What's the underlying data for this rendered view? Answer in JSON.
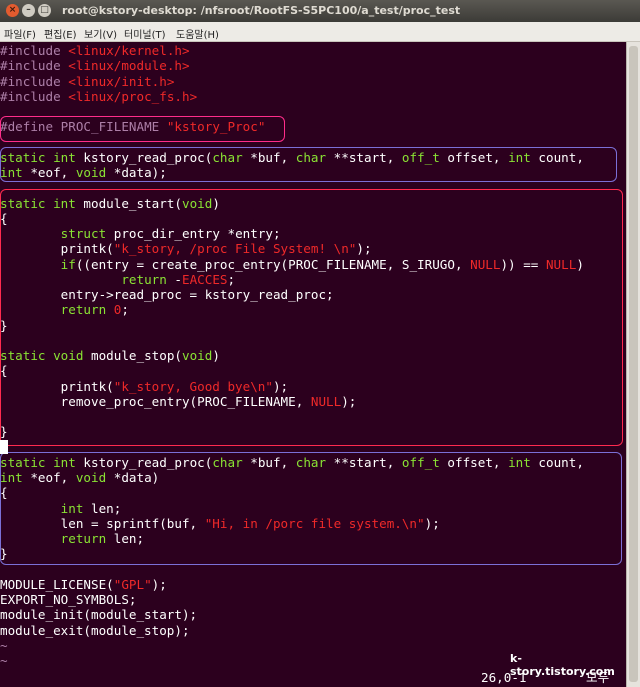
{
  "window": {
    "title": "root@kstory-desktop: /nfsroot/RootFS-S5PC100/a_test/proc_test",
    "close_glyph": "×",
    "min_glyph": "–",
    "max_glyph": "□"
  },
  "menu": [
    {
      "label": "파일(F)"
    },
    {
      "label": "편집(E)"
    },
    {
      "label": "보기(V)"
    },
    {
      "label": "터미널(T)"
    },
    {
      "label": "도움말(H)"
    }
  ],
  "editor": {
    "status_position": "26,0-1",
    "status_mode": "모두",
    "watermark": "k-story.tistory.com",
    "colors": {
      "background": "#2c001e",
      "keyword": "#8ae234",
      "preprocessor": "#ad7fa8",
      "string": "#ef2929",
      "box_include_define": "#ff2d8a",
      "box_prototype": "#7b6fd6",
      "box_module": "#ff2a4f"
    },
    "lines": [
      [
        {
          "t": "#include ",
          "c": "p"
        },
        {
          "t": "<linux/kernel.h>",
          "c": "s"
        }
      ],
      [
        {
          "t": "#include ",
          "c": "p"
        },
        {
          "t": "<linux/module.h>",
          "c": "s"
        }
      ],
      [
        {
          "t": "#include ",
          "c": "p"
        },
        {
          "t": "<linux/init.h>",
          "c": "s"
        }
      ],
      [
        {
          "t": "#include ",
          "c": "p"
        },
        {
          "t": "<linux/proc_fs.h>",
          "c": "s"
        }
      ],
      [],
      [
        {
          "t": "#define ",
          "c": "p"
        },
        {
          "t": "PROC_FILENAME ",
          "c": "c"
        },
        {
          "t": "\"kstory_Proc\"",
          "c": "s"
        }
      ],
      [],
      [
        {
          "t": "static",
          "c": "k"
        },
        {
          "t": " "
        },
        {
          "t": "int",
          "c": "k"
        },
        {
          "t": " kstory_read_proc("
        },
        {
          "t": "char",
          "c": "k"
        },
        {
          "t": " *buf, "
        },
        {
          "t": "char",
          "c": "k"
        },
        {
          "t": " **start, "
        },
        {
          "t": "off_t",
          "c": "k"
        },
        {
          "t": " offset, "
        },
        {
          "t": "int",
          "c": "k"
        },
        {
          "t": " count,"
        }
      ],
      [
        {
          "t": "int",
          "c": "k"
        },
        {
          "t": " *eof, "
        },
        {
          "t": "void",
          "c": "k"
        },
        {
          "t": " *data);"
        }
      ],
      [],
      [
        {
          "t": "static",
          "c": "k"
        },
        {
          "t": " "
        },
        {
          "t": "int",
          "c": "k"
        },
        {
          "t": " module_start("
        },
        {
          "t": "void",
          "c": "k"
        },
        {
          "t": ")"
        }
      ],
      [
        {
          "t": "{"
        }
      ],
      [
        {
          "t": "        "
        },
        {
          "t": "struct",
          "c": "k"
        },
        {
          "t": " proc_dir_entry *entry;"
        }
      ],
      [
        {
          "t": "        printk("
        },
        {
          "t": "\"k_story, /proc File System! \\n\"",
          "c": "s"
        },
        {
          "t": ");"
        }
      ],
      [
        {
          "t": "        "
        },
        {
          "t": "if",
          "c": "k"
        },
        {
          "t": "((entry = create_proc_entry(PROC_FILENAME, S_IRUGO, "
        },
        {
          "t": "NULL",
          "c": "s"
        },
        {
          "t": ")) == "
        },
        {
          "t": "NULL",
          "c": "s"
        },
        {
          "t": ")"
        }
      ],
      [
        {
          "t": "                "
        },
        {
          "t": "return",
          "c": "k"
        },
        {
          "t": " -"
        },
        {
          "t": "EACCES",
          "c": "s"
        },
        {
          "t": ";"
        }
      ],
      [
        {
          "t": "        entry->read_proc = kstory_read_proc;"
        }
      ],
      [
        {
          "t": "        "
        },
        {
          "t": "return",
          "c": "k"
        },
        {
          "t": " "
        },
        {
          "t": "0",
          "c": "s"
        },
        {
          "t": ";"
        }
      ],
      [
        {
          "t": "}"
        }
      ],
      [],
      [
        {
          "t": "static",
          "c": "k"
        },
        {
          "t": " "
        },
        {
          "t": "void",
          "c": "k"
        },
        {
          "t": " module_stop("
        },
        {
          "t": "void",
          "c": "k"
        },
        {
          "t": ")"
        }
      ],
      [
        {
          "t": "{"
        }
      ],
      [
        {
          "t": "        printk("
        },
        {
          "t": "\"k_story, Good bye\\n\"",
          "c": "s"
        },
        {
          "t": ");"
        }
      ],
      [
        {
          "t": "        remove_proc_entry(PROC_FILENAME, "
        },
        {
          "t": "NULL",
          "c": "s"
        },
        {
          "t": ");"
        }
      ],
      [],
      [
        {
          "t": "}"
        }
      ],
      [],
      [
        {
          "t": "static",
          "c": "k"
        },
        {
          "t": " "
        },
        {
          "t": "int",
          "c": "k"
        },
        {
          "t": " kstory_read_proc("
        },
        {
          "t": "char",
          "c": "k"
        },
        {
          "t": " *buf, "
        },
        {
          "t": "char",
          "c": "k"
        },
        {
          "t": " **start, "
        },
        {
          "t": "off_t",
          "c": "k"
        },
        {
          "t": " offset, "
        },
        {
          "t": "int",
          "c": "k"
        },
        {
          "t": " count,"
        }
      ],
      [
        {
          "t": "int",
          "c": "k"
        },
        {
          "t": " *eof, "
        },
        {
          "t": "void",
          "c": "k"
        },
        {
          "t": " *data)"
        }
      ],
      [
        {
          "t": "{"
        }
      ],
      [
        {
          "t": "        "
        },
        {
          "t": "int",
          "c": "k"
        },
        {
          "t": " len;"
        }
      ],
      [
        {
          "t": "        len = sprintf(buf, "
        },
        {
          "t": "\"Hi, in /porc file system.\\n\"",
          "c": "s"
        },
        {
          "t": ");"
        }
      ],
      [
        {
          "t": "        "
        },
        {
          "t": "return",
          "c": "k"
        },
        {
          "t": " len;"
        }
      ],
      [
        {
          "t": "}"
        }
      ],
      [],
      [
        {
          "t": "MODULE_LICENSE("
        },
        {
          "t": "\"GPL\"",
          "c": "s"
        },
        {
          "t": ");"
        }
      ],
      [
        {
          "t": "EXPORT_NO_SYMBOLS;"
        }
      ],
      [
        {
          "t": "module_init(module_start);"
        }
      ],
      [
        {
          "t": "module_exit(module_stop);"
        }
      ],
      [
        {
          "t": "~",
          "c": "p"
        }
      ],
      [
        {
          "t": "~",
          "c": "p"
        }
      ]
    ]
  }
}
